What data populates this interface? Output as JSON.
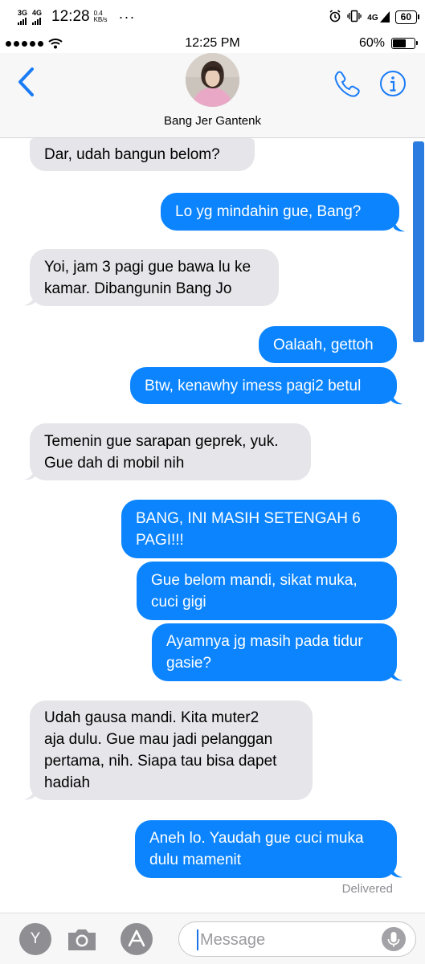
{
  "android_status": {
    "net1": "3G",
    "net2": "4G",
    "time": "12:28",
    "speed_value": "0.4",
    "speed_unit": "KB/s",
    "dots": "···",
    "lte": "4G",
    "battery": "60"
  },
  "ios_status": {
    "time": "12:25 PM",
    "battery_percent": "60%",
    "battery_level": 0.6
  },
  "header": {
    "contact_name": "Bang Jer Gantenk",
    "back_icon": "chevron-left-icon",
    "phone_icon": "phone-icon",
    "info_icon": "info-icon"
  },
  "messages": [
    {
      "side": "in",
      "text": "Dar,  udah bangun belom?"
    },
    {
      "side": "out",
      "text": "Lo yg mindahin gue,  Bang?"
    },
    {
      "side": "in",
      "text": "Yoi, jam 3 pagi gue bawa lu ke\nkamar. Dibangunin Bang Jo"
    },
    {
      "side": "out",
      "text": "Oalaah, gettoh"
    },
    {
      "side": "out",
      "text": "Btw,  kenawhy imess pagi2 betul"
    },
    {
      "side": "in",
      "text": "Temenin gue sarapan geprek, yuk.\nGue dah di mobil nih"
    },
    {
      "side": "out",
      "text": "BANG,  INI MASIH SETENGAH 6\nPAGI!!!"
    },
    {
      "side": "out",
      "text": "Gue belom mandi,  sikat muka,\ncuci gigi"
    },
    {
      "side": "out",
      "text": "Ayamnya jg masih pada tidur\ngasie?"
    },
    {
      "side": "in",
      "text": "Udah gausa mandi. Kita muter2\naja dulu. Gue mau jadi pelanggan\npertama, nih.  Siapa tau bisa dapet\nhadiah"
    },
    {
      "side": "out",
      "text": "Aneh lo. Yaudah gue cuci muka\ndulu mamenit"
    }
  ],
  "delivered_label": "Delivered",
  "compose": {
    "apps_label": "Y",
    "placeholder": "Message",
    "camera_icon": "camera-icon",
    "appstore_icon": "app-store-icon",
    "mic_icon": "microphone-icon"
  },
  "colors": {
    "outgoing": "#0b84fe",
    "incoming": "#e5e5ea",
    "ios_blue": "#1a7cf5"
  }
}
